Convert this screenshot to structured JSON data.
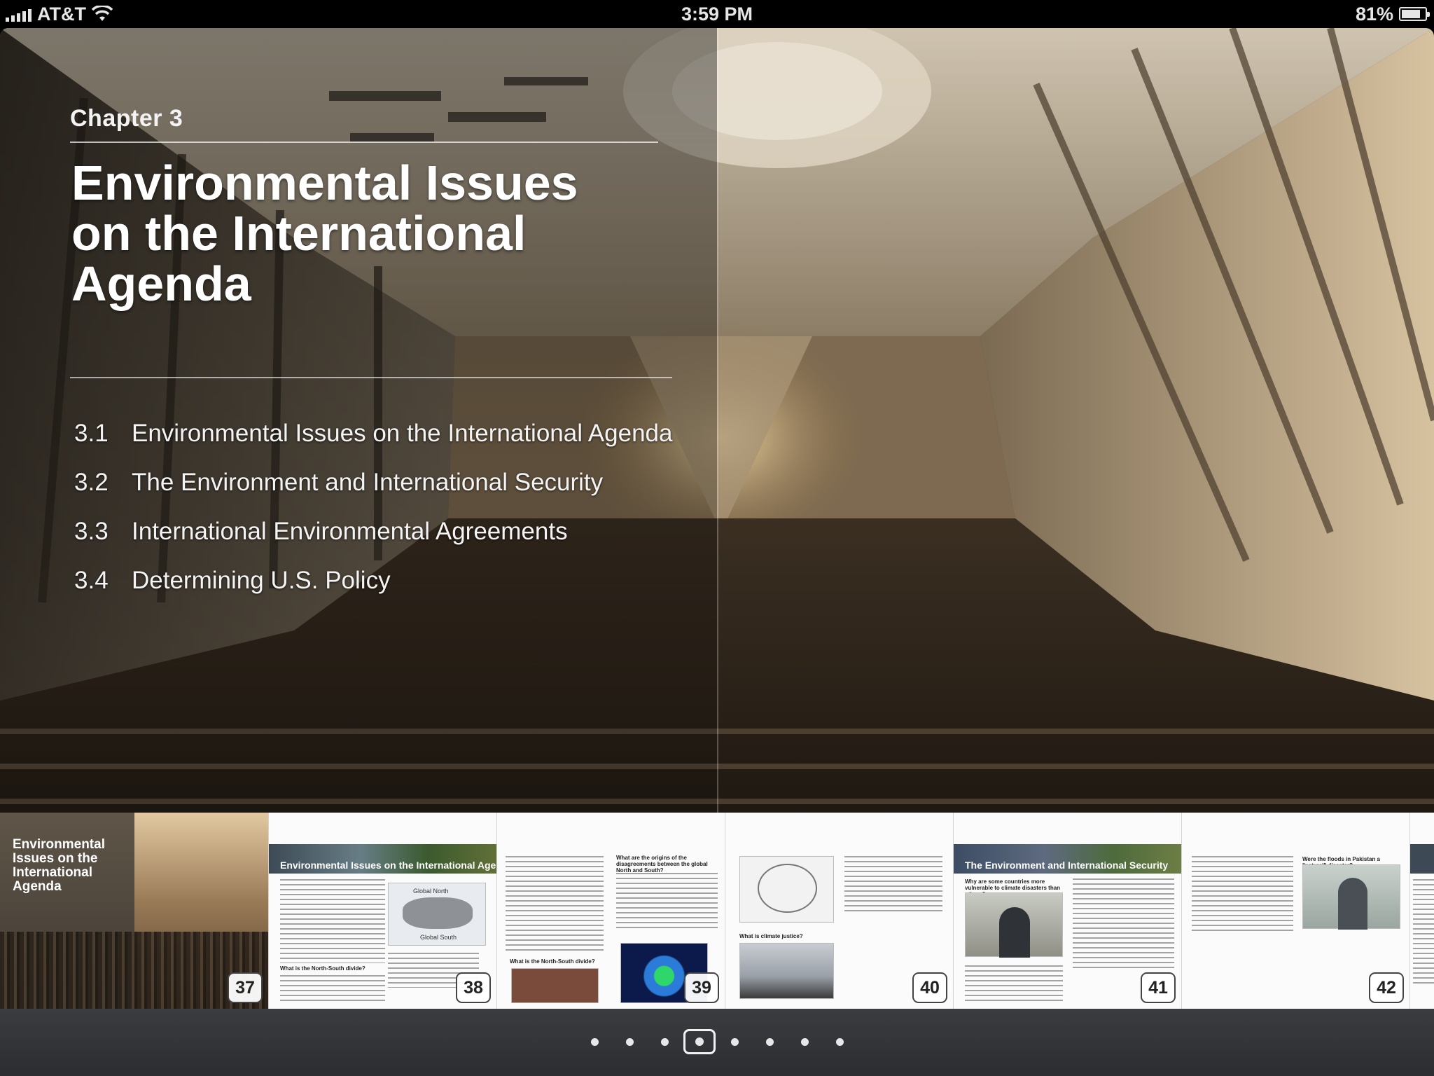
{
  "status_bar": {
    "carrier": "AT&T",
    "time": "3:59 PM",
    "battery": "81%",
    "battery_level": 0.81,
    "icons": [
      "signal-icon",
      "wifi-icon",
      "battery-icon"
    ]
  },
  "chapter": {
    "label": "Chapter 3",
    "title": "Environmental Issues on the International Agenda",
    "sections": [
      {
        "num": "3.1",
        "title": "Environmental Issues on the International Agenda"
      },
      {
        "num": "3.2",
        "title": "The Environment and International Security"
      },
      {
        "num": "3.3",
        "title": "International Environmental Agreements"
      },
      {
        "num": "3.4",
        "title": "Determining U.S. Policy"
      }
    ]
  },
  "thumbnails": [
    {
      "page": "37",
      "title": "Environmental Issues on the International Agenda"
    },
    {
      "page": "38",
      "banner": "Environmental Issues on the International Agenda",
      "map_north": "Global North",
      "map_south": "Global South",
      "head1": "What is the North-South divide?"
    },
    {
      "page": "39",
      "head1": "What are the origins of the disagreements between the global North and South?",
      "head2": "What is the North-South divide?"
    },
    {
      "page": "40",
      "head1": "What is climate justice?"
    },
    {
      "page": "41",
      "banner": "The Environment and International Security",
      "head1": "Why are some countries more vulnerable to climate disasters than others?"
    },
    {
      "page": "42",
      "head1": "Were the floods in Pakistan a \"natural\" disaster?"
    }
  ],
  "pager": {
    "count": 8,
    "active": 3
  }
}
